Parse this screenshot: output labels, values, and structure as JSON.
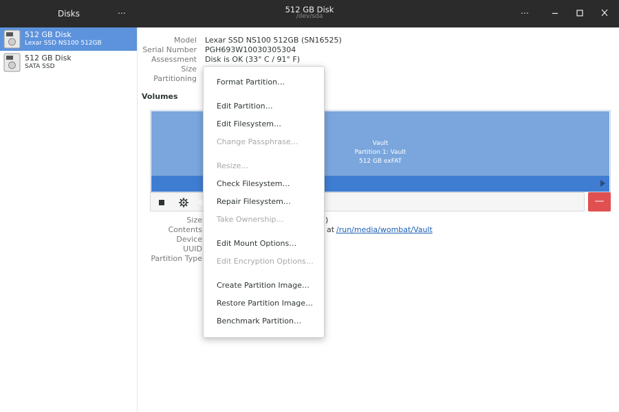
{
  "header": {
    "left_title": "Disks",
    "title": "512 GB Disk",
    "subtitle": "/dev/sda"
  },
  "sidebar": {
    "disks": [
      {
        "name": "512 GB Disk",
        "sub": "Lexar SSD NS100 512GB"
      },
      {
        "name": "512 GB Disk",
        "sub": "SATA SSD"
      }
    ]
  },
  "drive": {
    "model_label": "Model",
    "model": "Lexar SSD NS100 512GB (SN16525)",
    "serial_label": "Serial Number",
    "serial": "PGH693W10030305304",
    "assessment_label": "Assessment",
    "assessment": "Disk is OK (33° C / 91° F)",
    "size_label": "Size",
    "partitioning_label": "Partitioning"
  },
  "volumes": {
    "title": "Volumes",
    "partition_name": "Vault",
    "partition_line": "Partition 1: Vault",
    "partition_size": "512 GB exFAT"
  },
  "partition_info": {
    "size_label": "Size",
    "size_tail": "l)",
    "contents_label": "Contents",
    "contents_tail": "at",
    "mount_link": "/run/media/wombat/Vault",
    "device_label": "Device",
    "uuid_label": "UUID",
    "type_label": "Partition Type"
  },
  "menu": {
    "items": [
      {
        "label": "Format Partition…"
      },
      {
        "label": "Edit Partition…"
      },
      {
        "label": "Edit Filesystem…"
      },
      {
        "label": "Change Passphrase…"
      },
      {
        "label": "Resize…"
      },
      {
        "label": "Check Filesystem…"
      },
      {
        "label": "Repair Filesystem…"
      },
      {
        "label": "Take Ownership…"
      },
      {
        "label": "Edit Mount Options…"
      },
      {
        "label": "Edit Encryption Options…"
      },
      {
        "label": "Create Partition Image…"
      },
      {
        "label": "Restore Partition Image…"
      },
      {
        "label": "Benchmark Partition…"
      }
    ]
  },
  "colors": {
    "header_bg": "#2b2b2b",
    "selection": "#5d93dc",
    "partition_fill": "#7aa6dd",
    "partition_bar": "#3f7dd3",
    "delete_red": "#e05050"
  }
}
